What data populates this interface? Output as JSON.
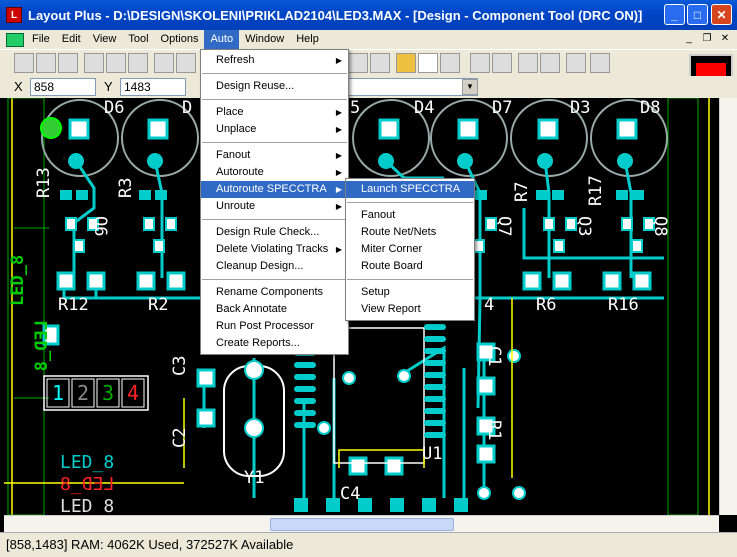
{
  "window": {
    "title": "Layout Plus - D:\\DESIGN\\SKOLENI\\PRIKLAD2104\\LED3.MAX - [Design - Component Tool (DRC ON)]",
    "app_icon_glyph": "L"
  },
  "menubar": {
    "items": [
      "File",
      "Edit",
      "View",
      "Tool",
      "Options",
      "Auto",
      "Window",
      "Help"
    ],
    "active": "Auto"
  },
  "coords": {
    "x_label": "X",
    "x_value": "858",
    "y_label": "Y",
    "y_value": "1483"
  },
  "auto_menu": {
    "items": [
      "Refresh",
      "Design Reuse...",
      "Place",
      "Unplace",
      "Fanout",
      "Autoroute",
      "Autoroute SPECCTRA",
      "Unroute",
      "Design Rule Check...",
      "Delete Violating Tracks",
      "Cleanup Design...",
      "Rename Components",
      "Back Annotate",
      "Run Post Processor",
      "Create Reports..."
    ]
  },
  "specctra_menu": {
    "items": [
      "Launch SPECCTRA",
      "Fanout",
      "Route Net/Nets",
      "Miter Corner",
      "Route Board",
      "Setup",
      "View Report"
    ]
  },
  "canvas": {
    "labels": {
      "d6": "D6",
      "d_partial": "D",
      "d5_partial": "5",
      "d4": "D4",
      "d7": "D7",
      "d3": "D3",
      "d8": "D8",
      "r13": "R13",
      "r3": "R3",
      "r7": "R7",
      "r17": "R17",
      "q6": "Q6",
      "q7": "Q7",
      "q3": "Q3",
      "q8": "Q8",
      "r12": "R12",
      "r2": "R2",
      "r4_partial": "4",
      "r6": "R6",
      "r16": "R16",
      "c3": "C3",
      "c2": "C2",
      "y1": "Y1",
      "c4": "C4",
      "u1": "U1",
      "c1": "C1",
      "r1": "R1",
      "led8_side": "LED_8",
      "led8_mirrored_side": "LED_8",
      "led8_bottom": "LED_8",
      "led8_mirror_bottom": "LED_8",
      "led8_bottom2": "LED_8",
      "layer1": "1",
      "layer2": "2",
      "layer3": "3",
      "layer4": "4"
    }
  },
  "status": {
    "text": "[858,1483]   RAM: 4062K Used, 372527K Available"
  }
}
